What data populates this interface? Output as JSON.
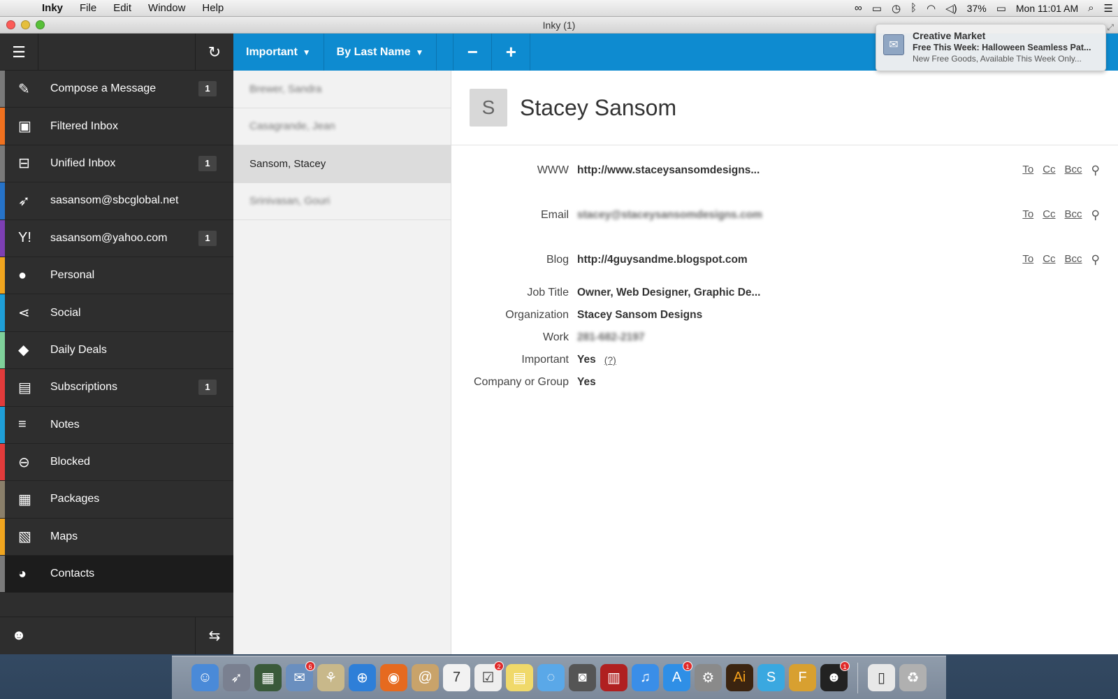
{
  "menubar": {
    "apple_icon": "apple-logo-icon",
    "app_name": "Inky",
    "menus": [
      "File",
      "Edit",
      "Window",
      "Help"
    ],
    "status_icons": [
      "creative-cloud-icon",
      "airplay-icon",
      "time-machine-icon",
      "bluetooth-icon",
      "wifi-icon",
      "volume-icon"
    ],
    "battery_percent": "37%",
    "clock": "Mon 11:01 AM"
  },
  "window": {
    "title": "Inky (1)"
  },
  "sidebar": {
    "items": [
      {
        "label": "Compose a Message",
        "badge": "1",
        "icon": "compose-icon",
        "color": "#7a7a7a"
      },
      {
        "label": "Filtered Inbox",
        "badge": "",
        "icon": "filtered-inbox-icon",
        "color": "#f0711f"
      },
      {
        "label": "Unified Inbox",
        "badge": "1",
        "icon": "inbox-icon",
        "color": "#7a7a7a"
      },
      {
        "label": "sasansom@sbcglobal.net",
        "badge": "",
        "icon": "rocket-icon",
        "color": "#2673c9"
      },
      {
        "label": "sasansom@yahoo.com",
        "badge": "1",
        "icon": "yahoo-icon",
        "color": "#7d3fb3"
      },
      {
        "label": "Personal",
        "badge": "",
        "icon": "person-icon",
        "color": "#f0a51f"
      },
      {
        "label": "Social",
        "badge": "",
        "icon": "share-icon",
        "color": "#1f9fd8"
      },
      {
        "label": "Daily Deals",
        "badge": "",
        "icon": "tag-icon",
        "color": "#7fd09a"
      },
      {
        "label": "Subscriptions",
        "badge": "1",
        "icon": "newspaper-icon",
        "color": "#e23b3b"
      },
      {
        "label": "Notes",
        "badge": "",
        "icon": "notes-icon",
        "color": "#1f9fd8"
      },
      {
        "label": "Blocked",
        "badge": "",
        "icon": "blocked-icon",
        "color": "#e23b3b"
      },
      {
        "label": "Packages",
        "badge": "",
        "icon": "package-icon",
        "color": "#8a7f6a"
      },
      {
        "label": "Maps",
        "badge": "",
        "icon": "map-icon",
        "color": "#f0a51f"
      },
      {
        "label": "Contacts",
        "badge": "",
        "icon": "contacts-icon",
        "color": "#7a7a7a"
      }
    ]
  },
  "toolbar": {
    "filter_label": "Important",
    "sort_label": "By Last Name",
    "remove_label": "−",
    "add_label": "+"
  },
  "contacts": [
    {
      "name": "Brewer, Sandra",
      "blurred": true
    },
    {
      "name": "Casagrande, Jean",
      "blurred": true
    },
    {
      "name": "Sansom, Stacey",
      "blurred": false,
      "selected": true
    },
    {
      "name": "Srinivasan, Gouri",
      "blurred": true
    }
  ],
  "detail": {
    "initial": "S",
    "name": "Stacey Sansom",
    "fields": {
      "www": {
        "label": "WWW",
        "value": "http://www.staceysansomdesigns..."
      },
      "email": {
        "label": "Email",
        "value": "stacey@staceysansomdesigns.com"
      },
      "blog": {
        "label": "Blog",
        "value": "http://4guysandme.blogspot.com"
      },
      "job_title": {
        "label": "Job Title",
        "value": "Owner, Web Designer, Graphic De..."
      },
      "organization": {
        "label": "Organization",
        "value": "Stacey Sansom Designs"
      },
      "work": {
        "label": "Work",
        "value": "281-682-2197"
      },
      "important": {
        "label": "Important",
        "value": "Yes",
        "help": "(?)"
      },
      "company": {
        "label": "Company or Group",
        "value": "Yes"
      }
    },
    "actions": {
      "to": "To",
      "cc": "Cc",
      "bcc": "Bcc"
    }
  },
  "notification": {
    "app": "Creative Market",
    "subtitle": "Free This Week: Halloween Seamless Pat...",
    "body": "New Free Goods, Available This Week Only..."
  },
  "dock": {
    "items": [
      {
        "name": "finder-icon",
        "color": "#4a8ad8",
        "badge": ""
      },
      {
        "name": "launchpad-icon",
        "color": "#7a8090",
        "badge": ""
      },
      {
        "name": "mission-control-icon",
        "color": "#3a5a3a",
        "badge": ""
      },
      {
        "name": "mail-icon",
        "color": "#6a8fbf",
        "badge": "6"
      },
      {
        "name": "preview-icon",
        "color": "#c8b88a",
        "badge": ""
      },
      {
        "name": "safari-icon",
        "color": "#2e7fd8",
        "badge": ""
      },
      {
        "name": "firefox-icon",
        "color": "#e66a1f",
        "badge": ""
      },
      {
        "name": "contacts-app-icon",
        "color": "#c9a36a",
        "badge": ""
      },
      {
        "name": "calendar-icon",
        "color": "#f2f2f2",
        "badge": ""
      },
      {
        "name": "reminders-icon",
        "color": "#eeeeee",
        "badge": "2"
      },
      {
        "name": "stickies-icon",
        "color": "#f0d96a",
        "badge": ""
      },
      {
        "name": "messages-icon",
        "color": "#5aa8e8",
        "badge": ""
      },
      {
        "name": "facetime-icon",
        "color": "#555555",
        "badge": ""
      },
      {
        "name": "photo-booth-icon",
        "color": "#b02020",
        "badge": ""
      },
      {
        "name": "itunes-icon",
        "color": "#3a8ee8",
        "badge": ""
      },
      {
        "name": "app-store-icon",
        "color": "#2f8fe6",
        "badge": "1"
      },
      {
        "name": "system-preferences-icon",
        "color": "#8a8a8a",
        "badge": ""
      },
      {
        "name": "illustrator-icon",
        "color": "#3b2410",
        "badge": ""
      },
      {
        "name": "skype-icon",
        "color": "#3aa8e0",
        "badge": ""
      },
      {
        "name": "fontcase-icon",
        "color": "#d8a030",
        "badge": ""
      },
      {
        "name": "inky-icon",
        "color": "#222222",
        "badge": "1"
      },
      {
        "name": "document-icon",
        "color": "#e8e8e8",
        "badge": ""
      },
      {
        "name": "trash-icon",
        "color": "#b0b0b0",
        "badge": ""
      }
    ]
  }
}
